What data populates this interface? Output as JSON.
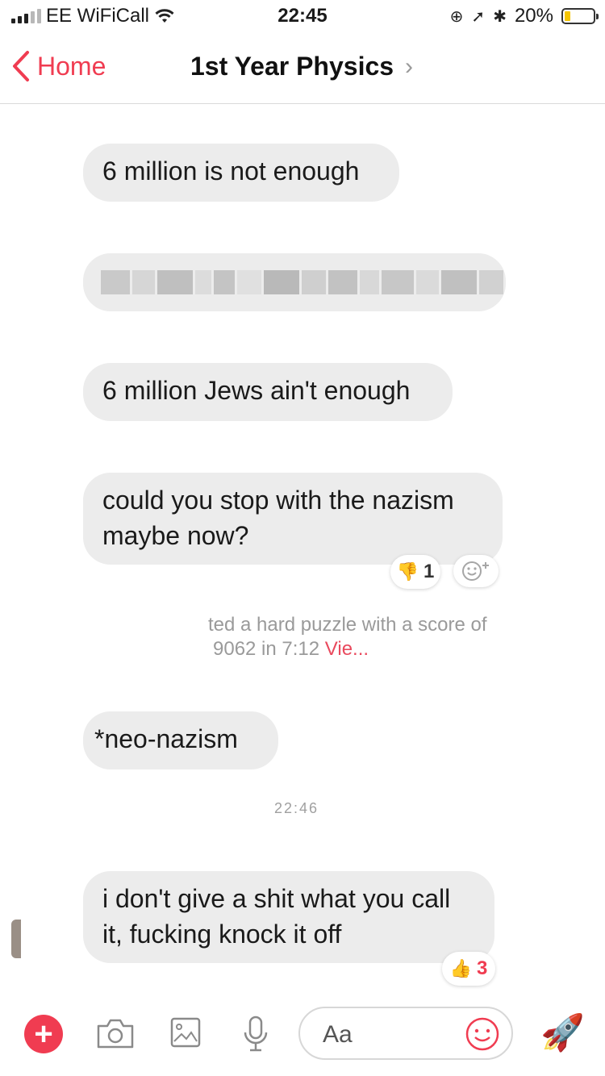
{
  "status_bar": {
    "carrier": "EE WiFiCall",
    "time": "22:45",
    "battery": "20%",
    "battery_level": 0.2
  },
  "nav": {
    "back_label": "Home",
    "title": "1st Year Physics",
    "chevron": "›"
  },
  "messages": [
    {
      "text": "6 million is not enough"
    },
    {
      "text": ""
    },
    {
      "text": "6 million Jews ain't enough"
    },
    {
      "text": "could you stop with the nazism maybe now?"
    },
    {
      "text": "*neo-nazism"
    },
    {
      "text": "i don't give a shit what you call it, fucking knock it off"
    }
  ],
  "reactions": {
    "thumbs_down_count": "1",
    "thumbs_up_count": "3"
  },
  "system_message": {
    "line1": "ted a hard puzzle with a score of",
    "line2_prefix": "9062 in 7:12",
    "line2_link": "Vie..."
  },
  "faint_time": "22:46",
  "composer": {
    "placeholder": "Aa",
    "plus": "+",
    "rocket": "🚀"
  },
  "colors": {
    "accent": "#f03c51",
    "bubble": "#ececec",
    "link": "#e9495d"
  }
}
